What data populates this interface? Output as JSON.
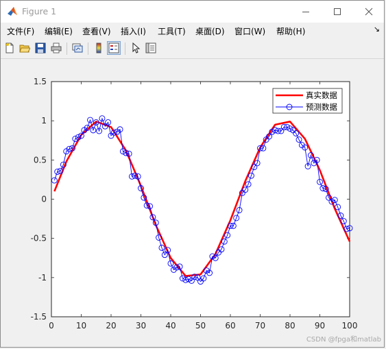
{
  "window": {
    "title": "Figure 1"
  },
  "menu": {
    "items": [
      "文件(F)",
      "编辑(E)",
      "查看(V)",
      "插入(I)",
      "工具(T)",
      "桌面(D)",
      "窗口(W)",
      "帮助(H)"
    ]
  },
  "toolbar": {
    "icons": [
      "new-figure-icon",
      "open-icon",
      "save-icon",
      "print-icon",
      "link-plot-icon",
      "colorbar-icon",
      "legend-icon",
      "pointer-icon",
      "property-inspector-icon"
    ]
  },
  "watermark": "CSDN @fpga和matlab",
  "colors": {
    "true": "#ff0000",
    "pred": "#0000ff"
  },
  "chart_data": {
    "type": "line",
    "title": "",
    "xlabel": "",
    "ylabel": "",
    "xlim": [
      0,
      100
    ],
    "ylim": [
      -1.5,
      1.5
    ],
    "xticks": [
      "0",
      "10",
      "20",
      "30",
      "40",
      "50",
      "60",
      "70",
      "80",
      "90",
      "100"
    ],
    "yticks": [
      "1.5",
      "1",
      "0.5",
      "0",
      "-0.5",
      "-1",
      "-1.5"
    ],
    "grid": false,
    "legend": "top-right",
    "series": [
      {
        "name": "真实数据",
        "x": [
          1,
          5,
          10,
          15,
          20,
          25,
          30,
          35,
          40,
          45,
          50,
          55,
          60,
          65,
          70,
          75,
          80,
          85,
          90,
          95,
          100
        ],
        "y": [
          0.1,
          0.48,
          0.82,
          0.99,
          0.92,
          0.62,
          0.17,
          -0.33,
          -0.75,
          -0.98,
          -0.96,
          -0.7,
          -0.27,
          0.23,
          0.66,
          0.95,
          0.99,
          0.77,
          0.37,
          -0.12,
          -0.54
        ]
      },
      {
        "name": "预测数据",
        "x": [
          1,
          2,
          3,
          4,
          5,
          6,
          7,
          8,
          9,
          10,
          11,
          12,
          13,
          14,
          15,
          16,
          17,
          18,
          19,
          20,
          21,
          22,
          23,
          24,
          25,
          26,
          27,
          28,
          29,
          30,
          31,
          32,
          33,
          34,
          35,
          36,
          37,
          38,
          39,
          40,
          41,
          42,
          43,
          44,
          45,
          46,
          47,
          48,
          49,
          50,
          51,
          52,
          53,
          54,
          55,
          56,
          57,
          58,
          59,
          60,
          61,
          62,
          63,
          64,
          65,
          66,
          67,
          68,
          69,
          70,
          71,
          72,
          73,
          74,
          75,
          76,
          77,
          78,
          79,
          80,
          81,
          82,
          83,
          84,
          85,
          86,
          87,
          88,
          89,
          90,
          91,
          92,
          93,
          94,
          95,
          96,
          97,
          98,
          99,
          100
        ],
        "y": [
          0.24,
          0.35,
          0.36,
          0.44,
          0.61,
          0.64,
          0.65,
          0.77,
          0.79,
          0.81,
          0.88,
          0.91,
          1.01,
          0.88,
          0.98,
          0.87,
          1.03,
          0.93,
          0.98,
          0.81,
          0.85,
          0.86,
          0.89,
          0.61,
          0.59,
          0.58,
          0.29,
          0.3,
          0.29,
          0.14,
          0.02,
          -0.08,
          -0.09,
          -0.23,
          -0.3,
          -0.49,
          -0.62,
          -0.71,
          -0.65,
          -0.82,
          -0.9,
          -0.87,
          -0.86,
          -1.01,
          -1.03,
          -1.02,
          -1.04,
          -0.99,
          -1.0,
          -1.05,
          -1.01,
          -0.91,
          -0.94,
          -0.73,
          -0.75,
          -0.68,
          -0.64,
          -0.54,
          -0.46,
          -0.34,
          -0.34,
          -0.24,
          -0.14,
          0.08,
          0.12,
          0.19,
          0.3,
          0.41,
          0.46,
          0.65,
          0.65,
          0.76,
          0.8,
          0.86,
          0.88,
          0.87,
          0.87,
          0.92,
          0.92,
          0.9,
          0.88,
          0.84,
          0.76,
          0.69,
          0.66,
          0.42,
          0.56,
          0.46,
          0.5,
          0.22,
          0.14,
          0.13,
          0.02,
          -0.03,
          -0.01,
          -0.1,
          -0.21,
          -0.28,
          -0.38,
          -0.37
        ]
      }
    ]
  }
}
